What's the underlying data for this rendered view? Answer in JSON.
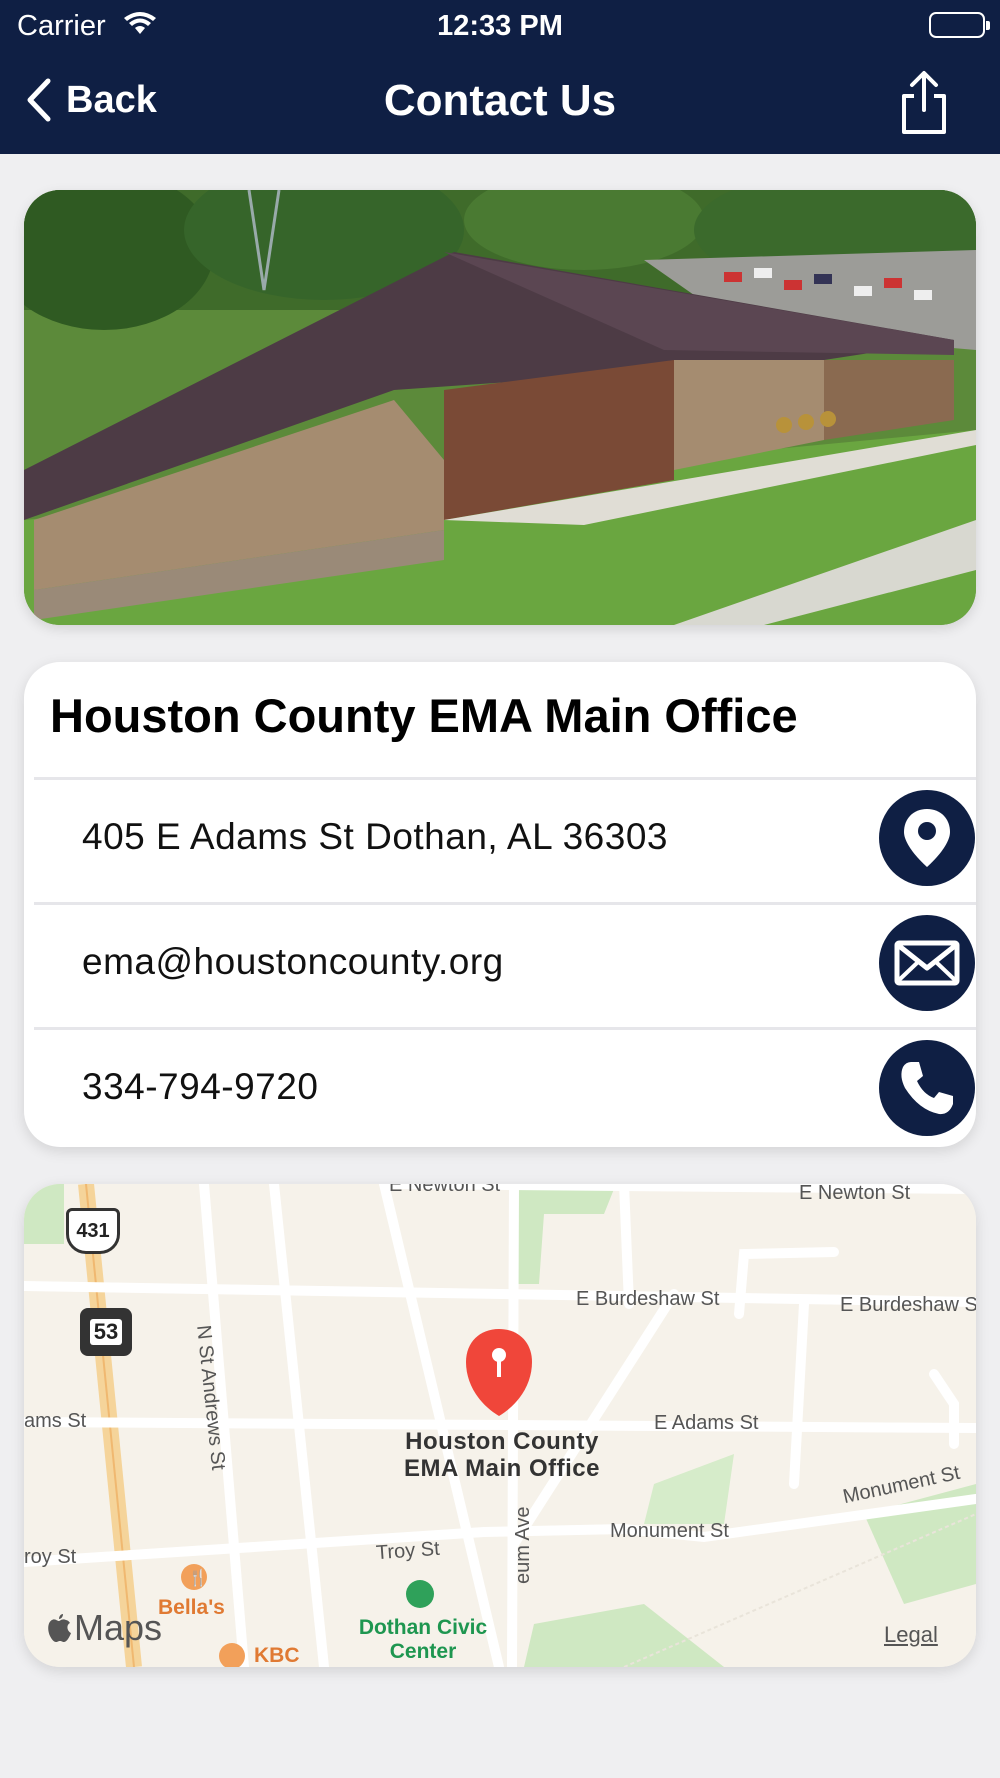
{
  "status_bar": {
    "carrier": "Carrier",
    "time": "12:33 PM"
  },
  "nav": {
    "back_label": "Back",
    "title": "Contact Us"
  },
  "colors": {
    "nav_background": "#0f1f44",
    "icon_circle": "#0f1f44",
    "page_background": "#efeff1",
    "map_pin": "#f0463a"
  },
  "contact_card": {
    "title": "Houston County EMA Main Office",
    "rows": [
      {
        "text": "405 E Adams St Dothan, AL 36303",
        "icon": "location-pin-icon"
      },
      {
        "text": "ema@houstoncounty.org",
        "icon": "envelope-icon"
      },
      {
        "text": "334-794-9720",
        "icon": "phone-icon"
      }
    ]
  },
  "map": {
    "pin_label": "Houston County\nEMA Main Office",
    "streets": {
      "e_newton": "E Newton St",
      "newton_top": "E Newton St",
      "e_burdeshaw_1": "E Burdeshaw St",
      "e_burdeshaw_2": "E Burdeshaw S",
      "adams_left": "ams St",
      "e_adams": "E Adams St",
      "monument_1": "Monument St",
      "monument_2": "Monument St",
      "troy_left": "roy St",
      "troy": "Troy St",
      "n_st_andrews": "N St Andrews St",
      "museum_ave": "eum Ave"
    },
    "shields": {
      "us_431": "431",
      "state_53": "53"
    },
    "pois": {
      "bellas": "Bella's",
      "kbc": "KBC",
      "civic_center": "Dothan Civic\nCenter"
    },
    "brand": "Maps",
    "legal": "Legal"
  }
}
